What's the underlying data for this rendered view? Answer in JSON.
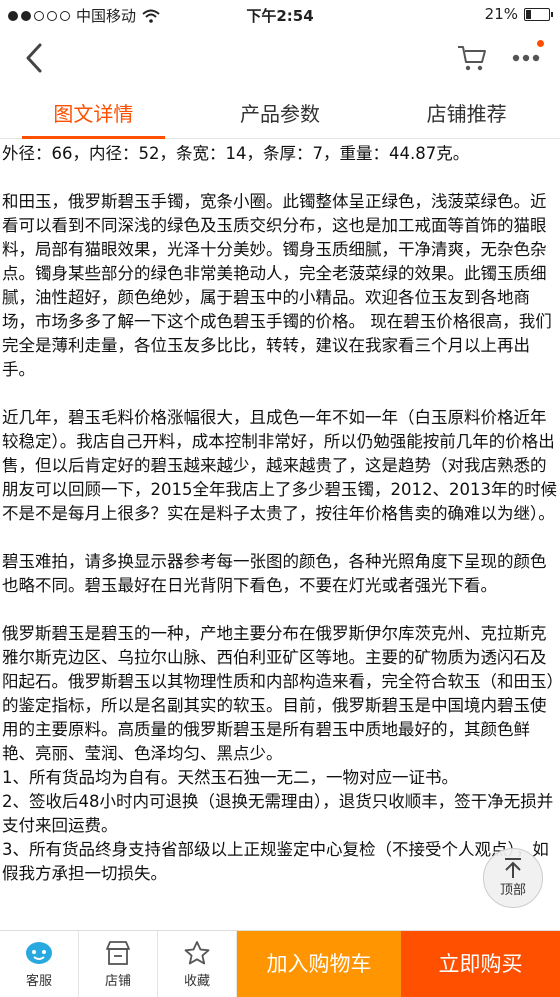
{
  "status_bar": {
    "carrier": "中国移动",
    "time": "下午2:54",
    "battery": "21%",
    "signal_bars": 2,
    "battery_level": 0.21
  },
  "nav": {
    "back_icon": "chevron-left-icon",
    "cart_icon": "shopping-cart-icon",
    "more_icon": "more-dots-icon"
  },
  "tabs": [
    {
      "label": "图文详情",
      "active": true
    },
    {
      "label": "产品参数",
      "active": false
    },
    {
      "label": "店铺推荐",
      "active": false
    }
  ],
  "content": {
    "paragraphs": [
      "外径：66，内径：52，条宽：14，条厚：7，重量：44.87克。",
      "和田玉，俄罗斯碧玉手镯，宽条小圈。此镯整体呈正绿色，浅菠菜绿色。近看可以看到不同深浅的绿色及玉质交织分布，这也是加工戒面等首饰的猫眼料，局部有猫眼效果，光泽十分美妙。镯身玉质细腻，干净清爽，无杂色杂点。镯身某些部分的绿色非常美艳动人，完全老菠菜绿的效果。此镯玉质细腻，油性超好，颜色绝妙，属于碧玉中的小精品。欢迎各位玉友到各地商场，市场多多了解一下这个成色碧玉手镯的价格。 现在碧玉价格很高，我们完全是薄利走量，各位玉友多比比，转转，建议在我家看三个月以上再出手。",
      "近几年，碧玉毛料价格涨幅很大，且成色一年不如一年（白玉原料价格近年较稳定）。我店自己开料，成本控制非常好，所以仍勉强能按前几年的价格出售，但以后肯定好的碧玉越来越少，越来越贵了，这是趋势（对我店熟悉的朋友可以回顾一下，2015全年我店上了多少碧玉镯，2012、2013年的时候不是不是每月上很多？实在是料子太贵了，按往年价格售卖的确难以为继）。",
      "碧玉难拍，请多换显示器参考每一张图的颜色，各种光照角度下呈现的颜色也略不同。碧玉最好在日光背阴下看色，不要在灯光或者强光下看。",
      "俄罗斯碧玉是碧玉的一种，产地主要分布在俄罗斯伊尔库茨克州、克拉斯克雅尔斯克边区、乌拉尔山脉、西伯利亚矿区等地。主要的矿物质为透闪石及阳起石。俄罗斯碧玉以其物理性质和内部构造来看，完全符合软玉（和田玉）的鉴定指标，所以是名副其实的软玉。目前，俄罗斯碧玉是中国境内碧玉使用的主要原料。高质量的俄罗斯碧玉是所有碧玉中质地最好的，其颜色鲜艳、亮丽、莹润、色泽均匀、黑点少。\n1、所有货品均为自有。天然玉石独一无二，一物对应一证书。\n2、签收后48小时内可退换（退换无需理由），退货只收顺丰，签干净无损并支付来回运费。\n3、所有货品终身支持省部级以上正规鉴定中心复检（不接受个人观点），如假我方承担一切损失。"
    ]
  },
  "scroll_top": {
    "label": "顶部",
    "icon": "arrow-up-icon"
  },
  "bottom_bar": {
    "service_label": "客服",
    "shop_label": "店铺",
    "favorite_label": "收藏",
    "add_cart_label": "加入购物车",
    "buy_now_label": "立即购买",
    "accent": "#ff5000",
    "add_cart_color": "#ff9500"
  }
}
